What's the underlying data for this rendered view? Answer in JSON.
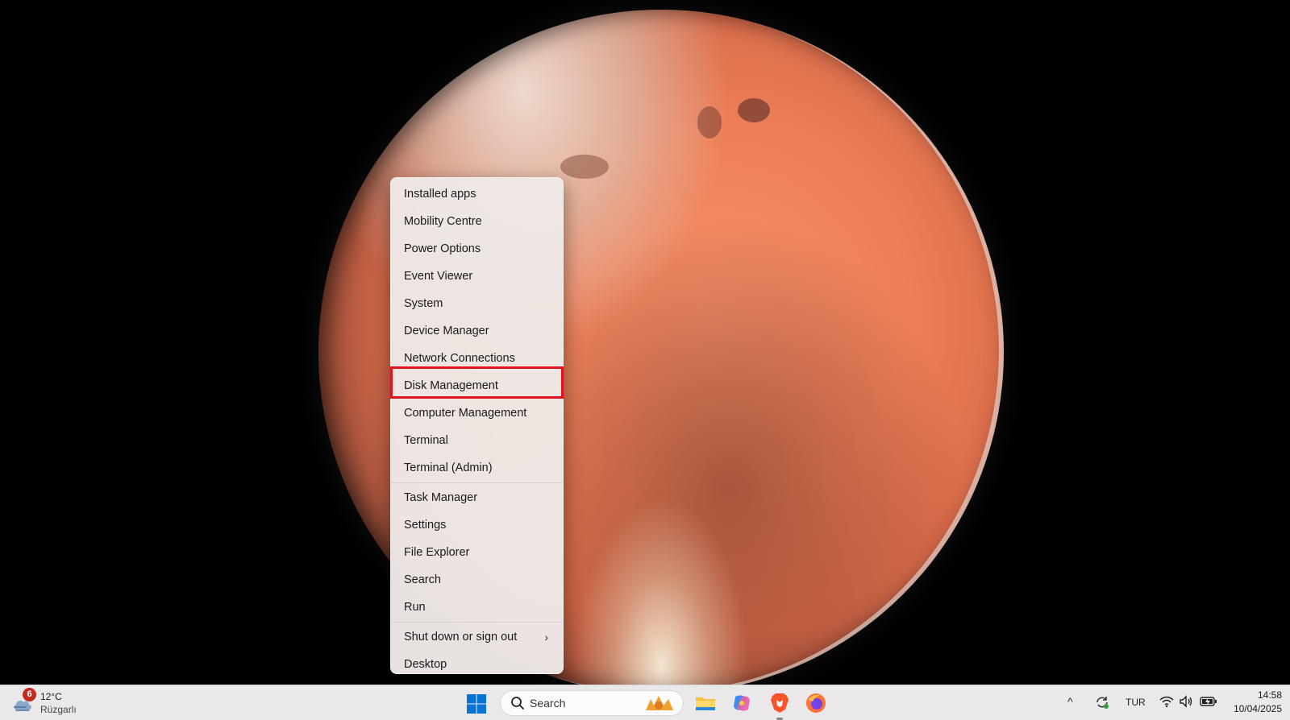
{
  "context_menu": {
    "items": [
      {
        "label": "Installed apps"
      },
      {
        "label": "Mobility Centre"
      },
      {
        "label": "Power Options"
      },
      {
        "label": "Event Viewer"
      },
      {
        "label": "System"
      },
      {
        "label": "Device Manager"
      },
      {
        "label": "Network Connections"
      },
      {
        "label": "Disk Management",
        "highlighted": true
      },
      {
        "label": "Computer Management"
      },
      {
        "label": "Terminal"
      },
      {
        "label": "Terminal (Admin)"
      },
      {
        "label": "Task Manager"
      },
      {
        "label": "Settings"
      },
      {
        "label": "File Explorer"
      },
      {
        "label": "Search"
      },
      {
        "label": "Run"
      },
      {
        "label": "Shut down or sign out",
        "has_submenu": true
      },
      {
        "label": "Desktop"
      }
    ],
    "highlight_color": "#e0141e"
  },
  "taskbar": {
    "weather": {
      "badge": "6",
      "temperature": "12°C",
      "condition": "Rüzgarlı",
      "icon": "wind-cloud-icon"
    },
    "search": {
      "placeholder": "Search"
    },
    "apps": [
      {
        "name": "File Explorer",
        "icon": "folder-icon"
      },
      {
        "name": "Copilot",
        "icon": "copilot-icon"
      },
      {
        "name": "Brave",
        "icon": "brave-icon"
      },
      {
        "name": "Firefox",
        "icon": "firefox-icon"
      }
    ],
    "tray": {
      "language": "TUR",
      "time": "14:58",
      "date": "10/04/2025"
    }
  },
  "colors": {
    "taskbar_bg": "#ebe8ea",
    "menu_bg": "#eee8e6",
    "windows_blue": "#0a74d4"
  }
}
